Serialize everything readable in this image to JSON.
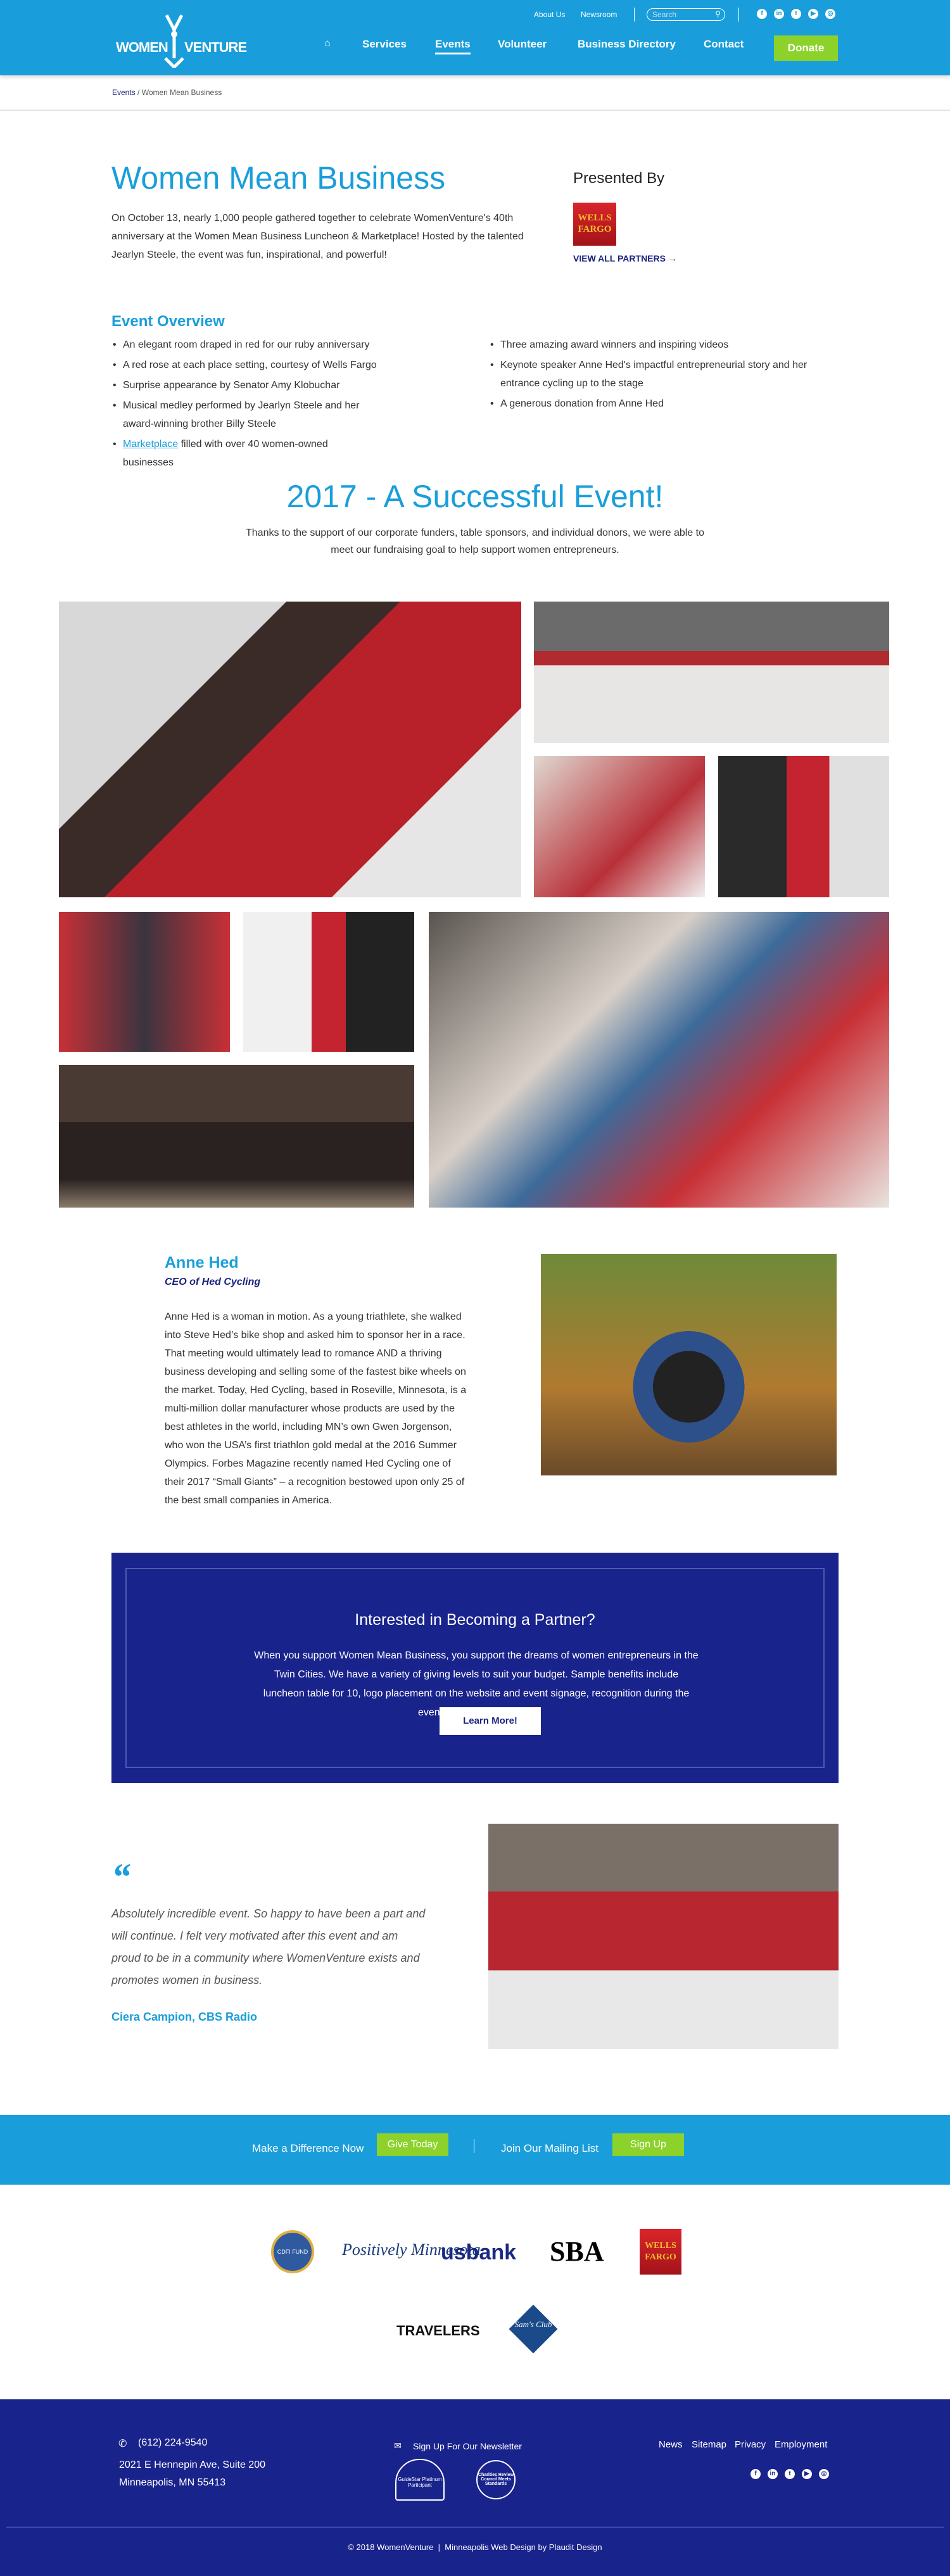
{
  "header": {
    "logo_text": "WOMEN VENTURE",
    "util_links": [
      "About Us",
      "Newsroom"
    ],
    "search_placeholder": "Search",
    "social": [
      "facebook",
      "linkedin",
      "twitter",
      "youtube",
      "instagram"
    ],
    "nav": [
      "Services",
      "Events",
      "Volunteer",
      "Business Directory",
      "Contact"
    ],
    "active_nav": "Events",
    "donate": "Donate"
  },
  "breadcrumb": {
    "parent": "Events",
    "separator": "/",
    "current": "Women Mean Business"
  },
  "event": {
    "title": "Women Mean Business",
    "intro": "On October 13, nearly 1,000 people gathered together to celebrate WomenVenture's 40th anniversary at the Women Mean Business Luncheon & Marketplace! Hosted by the talented Jearlyn Steele, the event was fun, inspirational, and powerful!",
    "presented_by": "Presented By",
    "sponsor_logo": "WELLS FARGO",
    "view_partners": "VIEW ALL PARTNERS"
  },
  "overview": {
    "title": "Event Overview",
    "left": [
      "An elegant room draped in red for our ruby anniversary",
      "A red rose at each place setting, courtesy of Wells Fargo",
      "Surprise appearance by Senator Amy Klobuchar",
      "Musical medley performed by Jearlyn Steele and her award-winning brother Billy Steele"
    ],
    "marketplace_link": "Marketplace",
    "marketplace_rest": " filled with over 40 women-owned businesses",
    "right": [
      "Three amazing award winners and inspiring videos",
      "Keynote speaker Anne Hed's impactful entrepreneurial story and her entrance cycling up to the stage",
      "A generous donation from Anne Hed"
    ]
  },
  "success": {
    "title": "2017 - A Successful Event!",
    "text": "Thanks to the support of our corporate funders, table sponsors, and individual donors, we were able to meet our fundraising goal to help support women entrepreneurs."
  },
  "speaker": {
    "name": "Anne Hed",
    "role": "CEO of Hed Cycling",
    "bio": "Anne Hed is a woman in motion. As a young triathlete, she walked into Steve Hed’s bike shop and asked him to sponsor her in a race. That meeting would ultimately lead to romance AND a thriving business developing and selling some of the fastest bike wheels on the market. Today, Hed Cycling, based in Roseville, Minnesota, is a multi-million dollar manufacturer whose products are used by the best athletes in the world, including MN’s own Gwen Jorgenson, who won the USA’s first triathlon gold medal at the 2016 Summer Olympics. Forbes Magazine recently named Hed Cycling one of their 2017 “Small Giants” – a recognition bestowed upon only 25 of the best small companies in America."
  },
  "partner": {
    "title": "Interested in Becoming a Partner?",
    "text": "When you support Women Mean Business, you support the dreams of women entrepreneurs in the Twin Cities. We have a variety of giving levels to suit your budget. Sample benefits include luncheon table for 10, logo placement on the website and event signage, recognition during the event program, and more!",
    "button": "Learn More!"
  },
  "testimonial": {
    "mark": "“",
    "quote": "Absolutely incredible event. So happy to have been a part and will continue. I felt very motivated after this event and am proud to be in a community where WomenVenture exists and promotes women in business.",
    "author": "Ciera Campion, CBS Radio"
  },
  "cta": {
    "give_label": "Make a Difference Now",
    "give_button": "Give Today",
    "mail_label": "Join Our Mailing List",
    "mail_button": "Sign Up"
  },
  "sponsors": [
    "CDFI FUND",
    "Positively Minnesota",
    "usbank",
    "SBA",
    "WELLS FARGO",
    "TRAVELERS",
    "Sam's Club"
  ],
  "footer": {
    "phone": "(612) 224-9540",
    "address1": "2021 E Hennepin Ave, Suite 200",
    "address2": "Minneapolis, MN 55413",
    "newsletter": "Sign Up For Our Newsletter",
    "badges": [
      "GuideStar Platinum Participant",
      "Charities Review Council Meets Standards"
    ],
    "links": [
      "News",
      "Sitemap",
      "Privacy",
      "Employment"
    ],
    "copyright": "© 2018 WomenVenture  |  Minneapolis Web Design by Plaudit Design"
  },
  "colors": {
    "primary_blue": "#1a9edb",
    "navy": "#19238c",
    "green": "#8cd22a"
  }
}
